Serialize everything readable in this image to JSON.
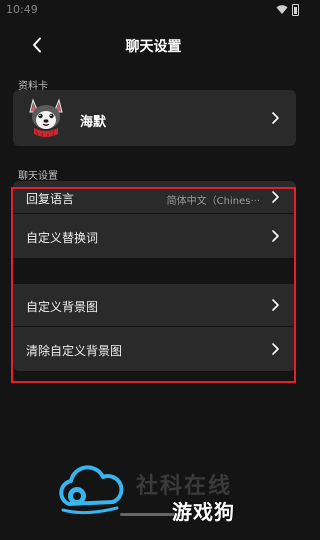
{
  "status_bar": {
    "time": "10:49"
  },
  "header": {
    "title": "聊天设置"
  },
  "profile_section": {
    "label": "资料卡",
    "name": "海默"
  },
  "chat_section": {
    "label": "聊天设置",
    "rows": [
      {
        "label": "回复语言",
        "value": "简体中文（Chines···"
      },
      {
        "label": "自定义替换词"
      },
      {
        "label": "自定义背景图"
      },
      {
        "label": "清除自定义背景图"
      }
    ]
  },
  "watermark": {
    "faint_text": "社科在线",
    "brand": "游戏狗"
  },
  "colors": {
    "highlight": "#e3202e",
    "accent_logo": "#38b4ee",
    "background": "#141414",
    "card": "#2a2a2a"
  }
}
